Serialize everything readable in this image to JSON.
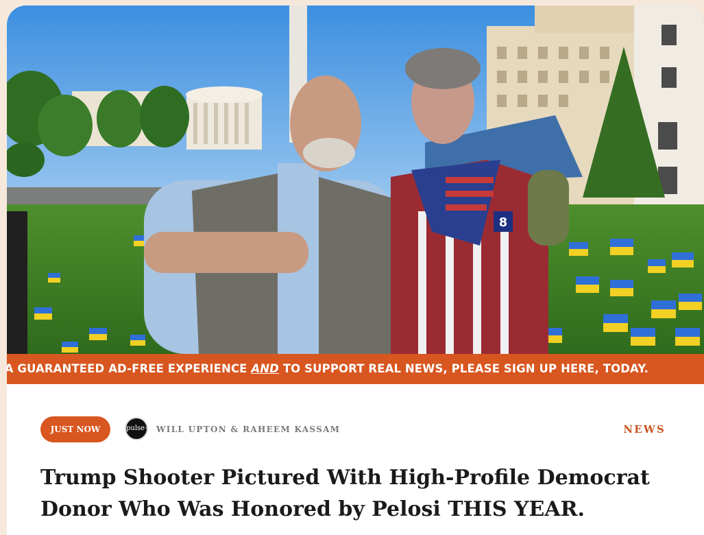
{
  "hero": {
    "flag_number": "8"
  },
  "banner": {
    "text_before": "R A GUARANTEED AD-FREE EXPERIENCE ",
    "text_emphasis": "AND",
    "text_after": " TO SUPPORT REAL NEWS, PLEASE SIGN UP HERE, TODAY."
  },
  "meta": {
    "badge_label": "JUST NOW",
    "avatar_label": "pulse+",
    "authors": "WILL UPTON & RAHEEM KASSAM",
    "category": "NEWS"
  },
  "article": {
    "headline": "Trump Shooter Pictured With High-Profile Democrat Donor Who Was Honored by Pelosi THIS YEAR."
  },
  "colors": {
    "accent": "#d8561f",
    "page_background": "#f6e9dc",
    "headline_text": "#1a1a1a",
    "meta_text": "#7a7a7a"
  }
}
